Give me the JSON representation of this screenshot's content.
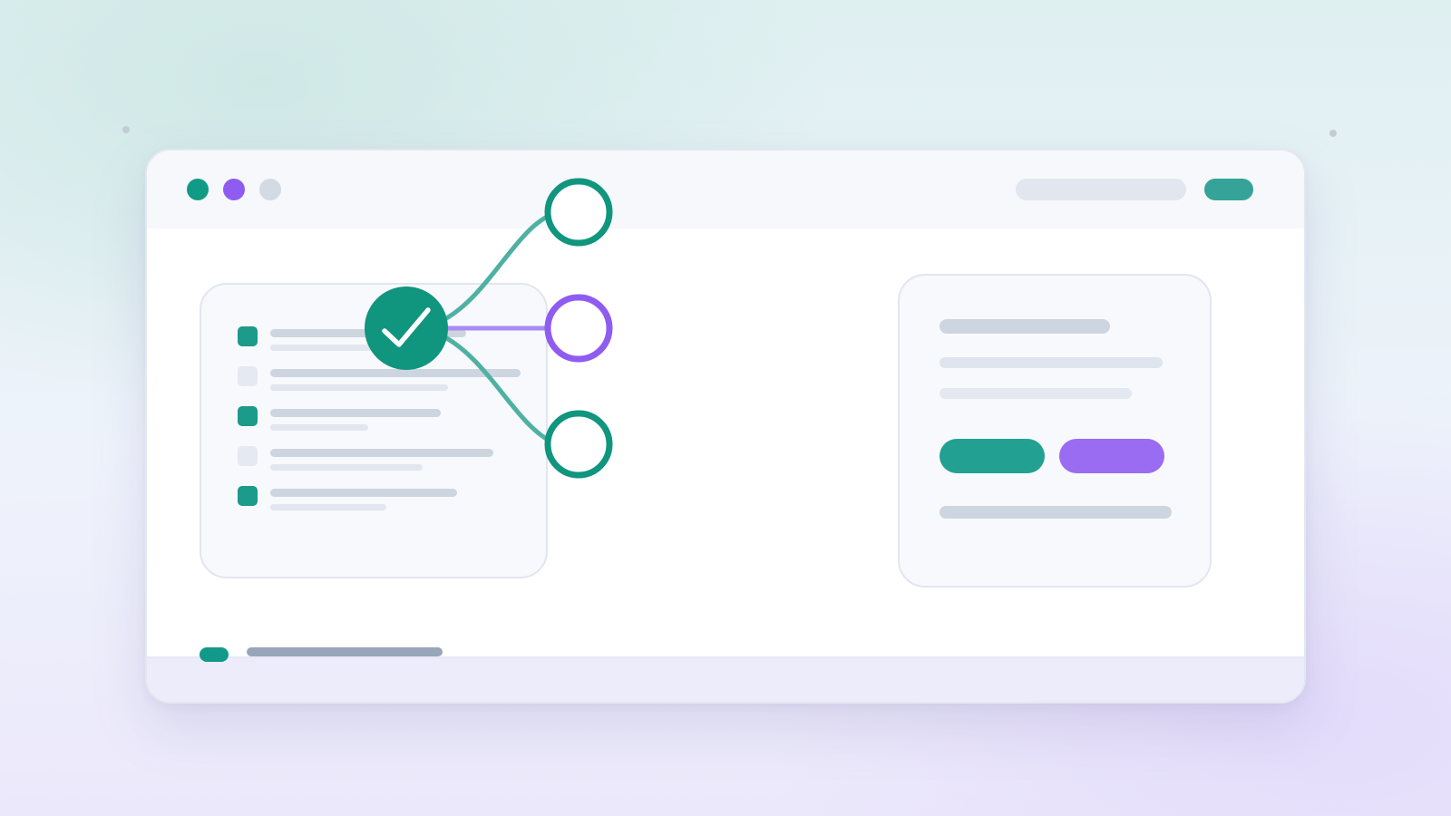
{
  "window": {
    "traffic_lights": [
      {
        "name": "light-1",
        "color": "#0f9b86"
      },
      {
        "name": "light-2",
        "color": "#8f5cf2"
      },
      {
        "name": "light-3",
        "color": "#d3dae4"
      }
    ],
    "address_bar_color": "#e1e6ef",
    "header_pill_color": "#35a397"
  },
  "task_list": {
    "items": [
      {
        "checked": true
      },
      {
        "checked": false
      },
      {
        "checked": true
      },
      {
        "checked": false
      },
      {
        "checked": true
      }
    ],
    "checked_color": "#1c9a8a",
    "unchecked_color": "#e5e9f1"
  },
  "flow": {
    "source_icon": "check-icon",
    "source_color": "#10957f",
    "targets": [
      {
        "name": "target-node-top",
        "color": "#10957f"
      },
      {
        "name": "target-node-middle",
        "color": "#8f5cf2"
      },
      {
        "name": "target-node-bottom",
        "color": "#10957f"
      }
    ]
  },
  "detail_card": {
    "primary_button_color": "#22a193",
    "secondary_button_color": "#9a6cf2"
  },
  "footer": {
    "status_pill_color": "#12998a",
    "progress_bar_color": "#97a6b8"
  }
}
